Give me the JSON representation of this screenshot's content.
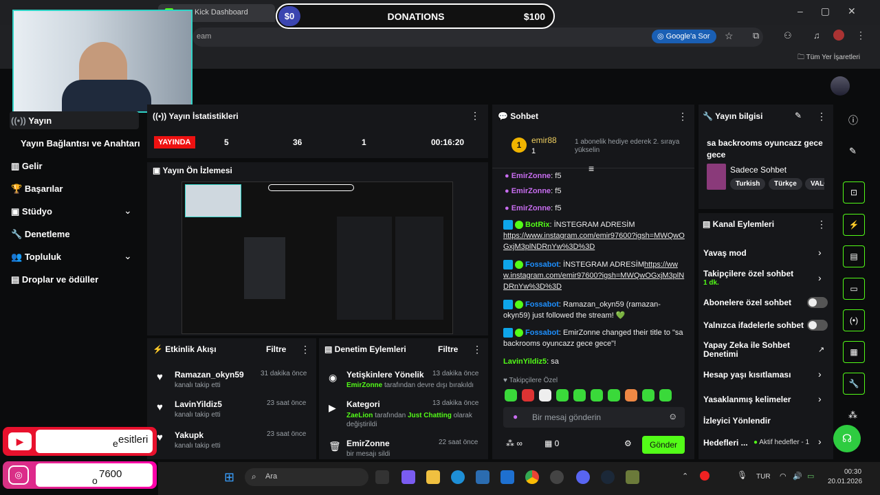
{
  "browser": {
    "tabs": [
      "Kick Dashboard",
      "am - Kick Dashboard"
    ],
    "address_fragment": "eam",
    "google_btn": "Google'a Sor",
    "bookmarks_label": "Tüm Yer İşaretleri"
  },
  "overlay": {
    "donation_left": "$0",
    "donation_title": "DONATIONS",
    "donation_right": "$100",
    "youtube_text": "esitleri",
    "instagram_text": "7600",
    "youtube_small": "e",
    "instagram_small": "o"
  },
  "sidebar": {
    "items": [
      {
        "label": "Yayın"
      },
      {
        "label": "Yayın Bağlantısı ve Anahtarı"
      },
      {
        "label": "Gelir"
      },
      {
        "label": "Başarılar"
      },
      {
        "label": "Stüdyo"
      },
      {
        "label": "Denetleme"
      },
      {
        "label": "Topluluk"
      },
      {
        "label": "Droplar ve ödüller"
      }
    ]
  },
  "stats": {
    "title": "Yayın İstatistikleri",
    "live": "YAYINDA",
    "v1": "5",
    "v2": "36",
    "v3": "1",
    "time": "00:16:20"
  },
  "preview": {
    "title": "Yayın Ön İzlemesi"
  },
  "activity": {
    "title": "Etkinlik Akışı",
    "filter": "Filtre",
    "items": [
      {
        "name": "Ramazan_okyn59",
        "sub": "kanalı takip etti",
        "time": "31 dakika önce"
      },
      {
        "name": "LavinYildiz5",
        "sub": "kanalı takip etti",
        "time": "23 saat önce"
      },
      {
        "name": "Yakupk",
        "sub": "kanalı takip etti",
        "time": "23 saat önce"
      }
    ]
  },
  "moderation": {
    "title": "Denetim Eylemleri",
    "filter": "Filtre",
    "items": [
      {
        "title": "Yetişkinlere Yönelik",
        "time": "13 dakika önce",
        "actor": "EmirZonne",
        "rest": " tarafından devre dışı bırakıldı"
      },
      {
        "title": "Kategori",
        "time": "13 dakika önce",
        "actor": "ZaeLion",
        "mid": " tarafından ",
        "cat": "Just Chatting",
        "rest": " olarak değiştirildi"
      },
      {
        "title": "EmirZonne",
        "time": "22 saat önce",
        "rest": "bir mesajı sildi"
      }
    ]
  },
  "chat": {
    "title": "Sohbet",
    "top_user": "emir88",
    "top_count": "1",
    "gift_note": "1 abonelik hediye ederek 2. sıraya yükselin",
    "partial_line": "EmirZonne: f5",
    "lines": [
      {
        "user": "EmirZonne",
        "text": ": f5"
      },
      {
        "user": "EmirZonne",
        "text": ": f5"
      }
    ],
    "bot1_user": "BotRix",
    "bot1_text": ": İNSTEGRAM ADRESİM",
    "bot1_link": "https://www.instagram.com/emir97600?igsh=MWQwOGxjM3plNDRnYw%3D%3D",
    "bot2_user": "Fossabot",
    "bot2_text": ": İNSTEGRAM ADRESİM",
    "bot2_link": "https://www.instagram.com/emir97600?igsh=MWQwOGxjM3plNDRnYw%3D%3D",
    "bot3_user": "Fossabot",
    "bot3_text": ": Ramazan_okyn59 (ramazan-okyn59) just followed the stream! 💚",
    "bot4_user": "Fossabot",
    "bot4_text": ": EmirZonne changed their title to \"sa backrooms oyuncazz gece gece\"!",
    "last_user": "LavinYildiz5",
    "last_text": ": sa",
    "followers_label": "Takipçilere Özel",
    "input_placeholder": "Bir mesaj gönderin",
    "points": "0",
    "send": "Gönder"
  },
  "info": {
    "title": "Yayın bilgisi",
    "stream_title": "sa backrooms oyuncazz gece gece",
    "category": "Sadece Sohbet",
    "tags": [
      "Turkish",
      "Türkçe",
      "VALO"
    ]
  },
  "channel": {
    "title": "Kanal Eylemleri",
    "items": [
      {
        "label": "Yavaş mod",
        "kind": "chev"
      },
      {
        "label": "Takipçilere özel sohbet",
        "sub": "1 dk.",
        "kind": "chev"
      },
      {
        "label": "Abonelere özel sohbet",
        "kind": "toggle"
      },
      {
        "label": "Yalnızca ifadelerle sohbet",
        "kind": "toggle"
      },
      {
        "label": "Yapay Zeka ile Sohbet Denetimi",
        "kind": "ext"
      },
      {
        "label": "Hesap yaşı kısıtlaması",
        "kind": "chev"
      },
      {
        "label": "Yasaklanmış kelimeler",
        "kind": "chev"
      },
      {
        "label": "İzleyici Yönlendir",
        "kind": "none"
      },
      {
        "label": "Hedefleri ...",
        "sub": "Aktif hedefler - 1",
        "kind": "chev"
      }
    ]
  },
  "taskbar": {
    "search": "Ara",
    "lang": "TUR",
    "time": "00:30",
    "date": "20.01.2026"
  }
}
